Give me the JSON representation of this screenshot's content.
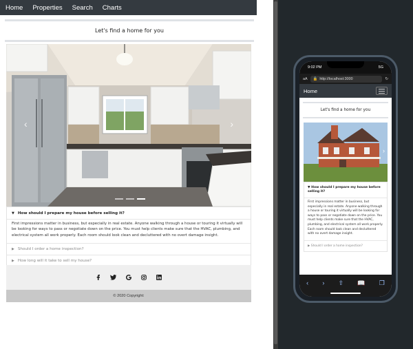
{
  "nav": {
    "items": [
      "Home",
      "Properties",
      "Search",
      "Charts"
    ]
  },
  "page": {
    "heading": "Let's find a home for you"
  },
  "faq": {
    "items": [
      {
        "question": "How should I prepare my house before selling it?",
        "answer": "First impressions matter in business, but especially in real estate. Anyone walking through a house or touring it virtually will be looking for ways to pass or negotiate down on the price. You must help clients make sure that the HVAC, plumbing, and electrical system all work properly. Each room should look clean and decluttered with no overt damage insight."
      },
      {
        "question": "Should I order a home inspection?"
      },
      {
        "question": "How long will it take to sell my house?"
      }
    ]
  },
  "footer": {
    "social_icons": [
      "facebook-icon",
      "twitter-icon",
      "google-icon",
      "instagram-icon",
      "linkedin-icon"
    ],
    "copyright": "© 2020 Copyright:"
  },
  "mobile": {
    "status": {
      "time": "9:02 PM",
      "signal": "5G"
    },
    "url": {
      "aa": "aA",
      "address": "http://localhost:3000"
    },
    "brand": "Home",
    "heading": "Let's find a home for you",
    "question": "How should I prepare my house before selling it?",
    "answer": "First impressions matter in business, but especially in real estate. Anyone walking through a house or touring it virtually will be looking for ways to pass or negotiate down on the price. You must help clients make sure that the HVAC, plumbing, and electrical system all work properly. Each room should look clean and decluttered with no overt damage insight.",
    "next_question": "Should I order a home inspection?"
  },
  "colors": {
    "navbar": "#343a40",
    "simulator_bg": "#22282c",
    "footer_social": "#efefef",
    "copyright_bg": "#c8c8c8"
  }
}
